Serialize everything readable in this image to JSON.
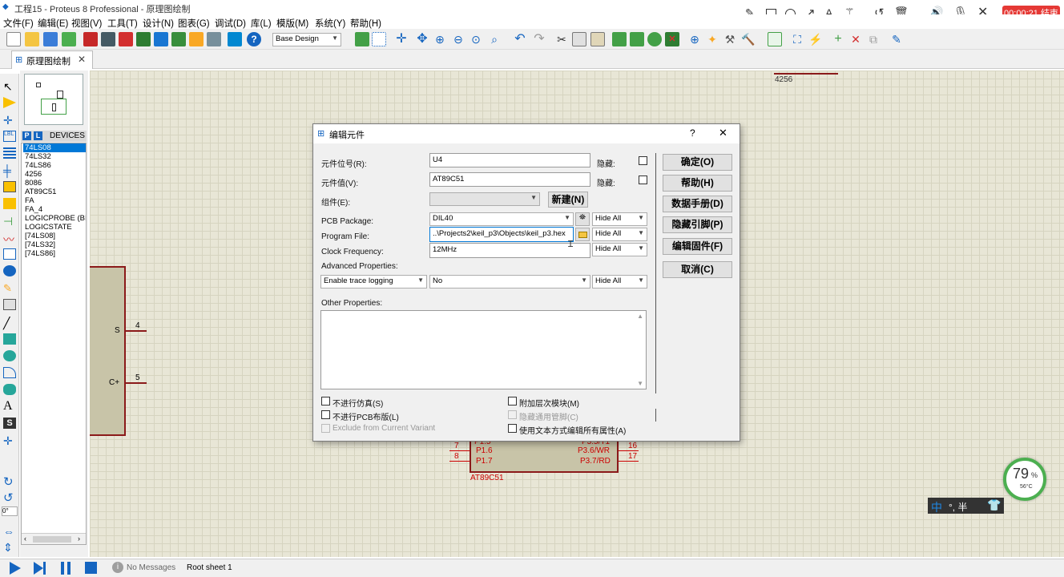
{
  "window": {
    "title": "工程15 - Proteus 8 Professional - 原理图绘制"
  },
  "menu": [
    "文件(F)",
    "编辑(E)",
    "视图(V)",
    "工具(T)",
    "设计(N)",
    "图表(G)",
    "调试(D)",
    "库(L)",
    "模版(M)",
    "系统(Y)",
    "帮助(H)"
  ],
  "recording": {
    "time": "00:00:21",
    "end_label": "结束"
  },
  "toolbar": {
    "layer_select": "Base Design"
  },
  "tab": {
    "label": "原理图绘制"
  },
  "devices": {
    "header": "DEVICES",
    "p_label": "P",
    "l_label": "L",
    "items": [
      "74LS08",
      "74LS32",
      "74LS86",
      "4256",
      "8086",
      "AT89C51",
      "FA",
      "FA_4",
      "LOGICPROBE (BIG",
      "LOGICSTATE",
      "[74LS08]",
      "[74LS32]",
      "[74LS86]"
    ],
    "selected_index": 0
  },
  "left_tools": {
    "angle": "0°"
  },
  "canvas": {
    "label_4256": "4256",
    "left_part": {
      "pin_s": "S",
      "pin_c": "C+",
      "num_4": "4",
      "num_5": "5"
    },
    "mcu": {
      "name": "AT89C51",
      "left_pins": [
        {
          "num": "7",
          "name": "P1.6"
        },
        {
          "num": "8",
          "name": "P1.7"
        }
      ],
      "right_pins": [
        {
          "num": "16",
          "name": "P3.6/WR"
        },
        {
          "num": "17",
          "name": "P3.7/RD"
        }
      ],
      "partial_left": "P1.5",
      "partial_right": "P3.5/T1"
    }
  },
  "dialog": {
    "title": "编辑元件",
    "help_glyph": "?",
    "close_glyph": "✕",
    "ref_label": "元件位号(R):",
    "ref_value": "U4",
    "value_label": "元件值(V):",
    "value_value": "AT89C51",
    "group_label": "组件(E):",
    "new_button": "新建(N)",
    "hidden_label_1": "隐藏:",
    "hidden_label_2": "隐藏:",
    "pcb_label": "PCB Package:",
    "pcb_value": "DIL40",
    "program_label": "Program File:",
    "program_value": "..\\Projects2\\keil_p3\\Objects\\keil_p3.hex",
    "clock_label": "Clock Frequency:",
    "clock_value": "12MHz",
    "hide_all": "Hide All",
    "advanced_label": "Advanced Properties:",
    "advanced_prop": "Enable trace logging",
    "advanced_value": "No",
    "other_label": "Other Properties:",
    "buttons": [
      "确定(O)",
      "帮助(H)",
      "数据手册(D)",
      "隐藏引脚(P)",
      "编辑固件(F)",
      "取消(C)"
    ],
    "checks": {
      "no_sim": "不进行仿真(S)",
      "no_pcb": "不进行PCB布版(L)",
      "exclude_variant": "Exclude from Current Variant",
      "attach_hier": "附加层次模块(M)",
      "hide_common": "隐藏通用管脚(C)",
      "edit_text": "使用文本方式编辑所有属性(A)"
    }
  },
  "status": {
    "messages": "No Messages",
    "sheet": "Root sheet 1"
  },
  "widget": {
    "cpu_percent": "79",
    "percent_sign": "%",
    "temp": "56°C"
  },
  "ime": {
    "mode": "中",
    "symbols": "°, 半"
  },
  "colors": {
    "accent": "#0078d7",
    "part_red": "#cc0000",
    "record_red": "#e53935",
    "part_fill": "#c8c4a8"
  }
}
